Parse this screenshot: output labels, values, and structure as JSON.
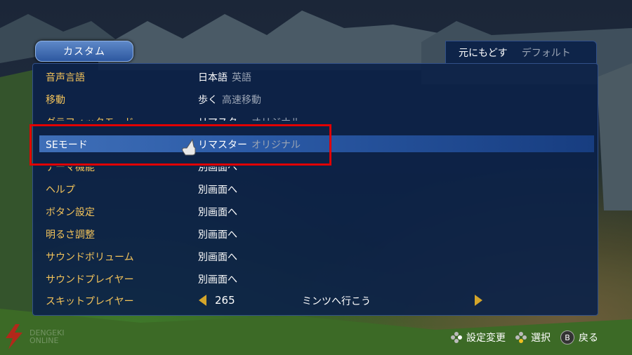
{
  "header": {
    "tab_label": "カスタム",
    "reset_label": "元にもどす",
    "default_label": "デフォルト"
  },
  "rows": [
    {
      "label": "音声言語",
      "value": "日本語",
      "alt": "英語"
    },
    {
      "label": "移動",
      "value": "歩く",
      "alt": "高速移動"
    },
    {
      "label": "グラフィックモード",
      "value": "リマスター",
      "alt": "オリジナル"
    },
    {
      "label": "SEモード",
      "value": "リマスター",
      "alt": "オリジナル"
    },
    {
      "label": "テーマ機能",
      "value": "別画面へ",
      "alt": ""
    },
    {
      "label": "ヘルプ",
      "value": "別画面へ",
      "alt": ""
    },
    {
      "label": "ボタン設定",
      "value": "別画面へ",
      "alt": ""
    },
    {
      "label": "明るさ調整",
      "value": "別画面へ",
      "alt": ""
    },
    {
      "label": "サウンドボリューム",
      "value": "別画面へ",
      "alt": ""
    },
    {
      "label": "サウンドプレイヤー",
      "value": "別画面へ",
      "alt": ""
    }
  ],
  "skit": {
    "label": "スキットプレイヤー",
    "number": "265",
    "title": "ミンツへ行こう"
  },
  "footer": {
    "change": "設定変更",
    "select": "選択",
    "back_button": "B",
    "back": "戻る"
  },
  "logo": {
    "line1": "DENGEKI",
    "line2": "ONLINE"
  },
  "colors": {
    "label": "#f3c35a",
    "highlight_border": "#e00000",
    "arrow": "#d4a52a"
  }
}
